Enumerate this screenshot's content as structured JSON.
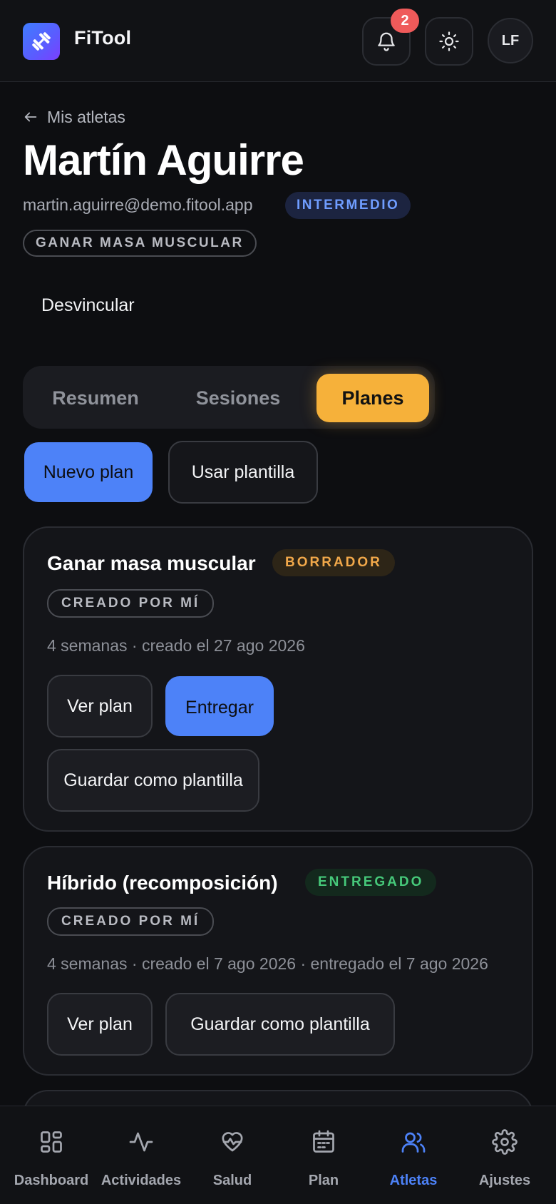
{
  "app": {
    "name": "FiTool",
    "avatar_initials": "LF",
    "notifications_count": "2",
    "accent": "#4d82f8",
    "tab_accent": "#f6b13a"
  },
  "header_icons": [
    "bell-icon",
    "sun-icon"
  ],
  "profile": {
    "back_label": "Mis atletas",
    "name": "Martín Aguirre",
    "email": "martin.aguirre@demo.fitool.app",
    "level": "INTERMEDIO",
    "goal": "GANAR MASA MUSCULAR",
    "unlink_label": "Desvincular"
  },
  "tabs": [
    {
      "label": "Resumen",
      "active": false
    },
    {
      "label": "Sesiones",
      "active": false
    },
    {
      "label": "Planes",
      "active": true
    }
  ],
  "actions": {
    "new_plan": "Nuevo plan",
    "use_template": "Usar plantilla"
  },
  "plans": [
    {
      "title": "Ganar masa muscular",
      "status": "BORRADOR",
      "creator": "CREADO POR MÍ",
      "meta": "4 semanas · creado el 27 ago 2026",
      "buttons": [
        "Ver plan",
        "Entregar",
        "Guardar como plantilla"
      ]
    },
    {
      "title": "Híbrido (recomposición)",
      "status": "ENTREGADO",
      "creator": "CREADO POR MÍ",
      "meta": "4 semanas · creado el 7 ago 2026 · entregado el 7 ago 2026",
      "buttons": [
        "Ver plan",
        "Guardar como plantilla"
      ]
    }
  ],
  "bottom_nav": [
    {
      "label": "Dashboard",
      "icon": "grid-icon",
      "active": false
    },
    {
      "label": "Actividades",
      "icon": "activity-icon",
      "active": false
    },
    {
      "label": "Salud",
      "icon": "heart-pulse-icon",
      "active": false
    },
    {
      "label": "Plan",
      "icon": "calendar-icon",
      "active": false
    },
    {
      "label": "Atletas",
      "icon": "users-icon",
      "active": true
    },
    {
      "label": "Ajustes",
      "icon": "settings-icon",
      "active": false
    }
  ]
}
